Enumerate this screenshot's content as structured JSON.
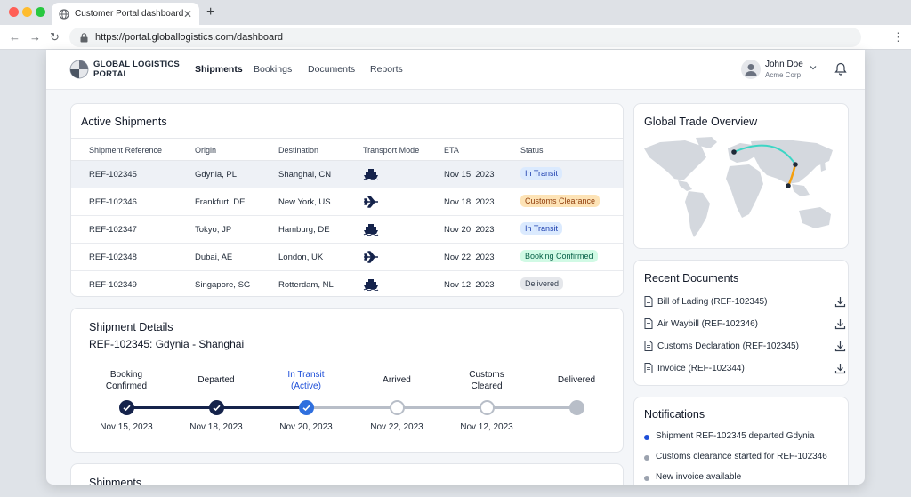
{
  "browser": {
    "tab_title": "Customer Portal dashboard",
    "url": "https://portal.globallogistics.com/dashboard"
  },
  "app": {
    "logo_line1": "GLOBAL LOGISTICS",
    "logo_line2": "PORTAL",
    "nav": [
      "Shipments",
      "Bookings",
      "Documents",
      "Reports"
    ],
    "active_nav": "Shipments",
    "user_name": "John Doe",
    "user_company": "Acme Corp"
  },
  "active_shipments": {
    "title": "Active Shipments",
    "columns": [
      "Shipment Reference",
      "Origin",
      "Destination",
      "Transport Mode",
      "ETA",
      "Status"
    ],
    "rows": [
      {
        "ref": "REF-102345",
        "origin": "Gdynia, PL",
        "destination": "Shanghai, CN",
        "mode": "ship-icon",
        "eta": "Nov 15, 2023",
        "status": "In Transit"
      },
      {
        "ref": "REF-102346",
        "origin": "Frankfurt, DE",
        "destination": "New York, US",
        "mode": "plane-icon",
        "eta": "Nov 18, 2023",
        "status": "Customs Clearance"
      },
      {
        "ref": "REF-102347",
        "origin": "Tokyo, JP",
        "destination": "Hamburg, DE",
        "mode": "ship-icon",
        "eta": "Nov 20, 2023",
        "status": "In Transit"
      },
      {
        "ref": "REF-102348",
        "origin": "Dubai, AE",
        "destination": "London, UK",
        "mode": "plane-icon",
        "eta": "Nov 22, 2023",
        "status": "Booking Confirmed"
      },
      {
        "ref": "REF-102349",
        "origin": "Singapore, SG",
        "destination": "Rotterdam, NL",
        "mode": "ship-icon",
        "eta": "Nov 12, 2023",
        "status": "Delivered"
      }
    ],
    "status_colors": {
      "In Transit": {
        "bg": "#dbeafe",
        "fg": "#1e40af"
      },
      "Customs Clearance": {
        "bg": "#fde3b6",
        "fg": "#92400e"
      },
      "Booking Confirmed": {
        "bg": "#d1fae5",
        "fg": "#065f46"
      },
      "Delivered": {
        "bg": "#e5e7eb",
        "fg": "#374151"
      }
    }
  },
  "shipment_details": {
    "title": "Shipment Details",
    "subtitle": "REF-102345: Gdynia - Shanghai",
    "steps": [
      {
        "label_line1": "Booking",
        "label_line2": "Confirmed",
        "date": "Nov 15, 2023",
        "state": "done"
      },
      {
        "label_line1": "Departed",
        "label_line2": "",
        "date": "Nov 18, 2023",
        "state": "done"
      },
      {
        "label_line1": "In Transit",
        "label_line2": "(Active)",
        "date": "Nov 20, 2023",
        "state": "active"
      },
      {
        "label_line1": "Arrived",
        "label_line2": "",
        "date": "Nov 22, 2023",
        "state": "pending"
      },
      {
        "label_line1": "Customs",
        "label_line2": "Cleared",
        "date": "Nov 12, 2023",
        "state": "pending"
      },
      {
        "label_line1": "Delivered",
        "label_line2": "",
        "date": "",
        "state": "end"
      }
    ]
  },
  "shipments_partial_title": "Shipments",
  "trade_overview": {
    "title": "Global Trade Overview"
  },
  "recent_documents": {
    "title": "Recent Documents",
    "items": [
      "Bill of Lading (REF-102345)",
      "Air Waybill (REF-102346)",
      "Customs Declaration (REF-102345)",
      "Invoice (REF-102344)"
    ]
  },
  "notifications": {
    "title": "Notifications",
    "items": [
      {
        "text": "Shipment REF-102345 departed Gdynia",
        "color": "#1d4ed8"
      },
      {
        "text": "Customs clearance started for REF-102346",
        "color": "#9ca3af"
      },
      {
        "text": "New invoice available",
        "color": "#9ca3af"
      }
    ]
  },
  "colors": {
    "brand_dark": "#15234b",
    "active_blue": "#2f6fde",
    "route_cyan": "#3dd6c5",
    "route_orange": "#f59e0b"
  }
}
